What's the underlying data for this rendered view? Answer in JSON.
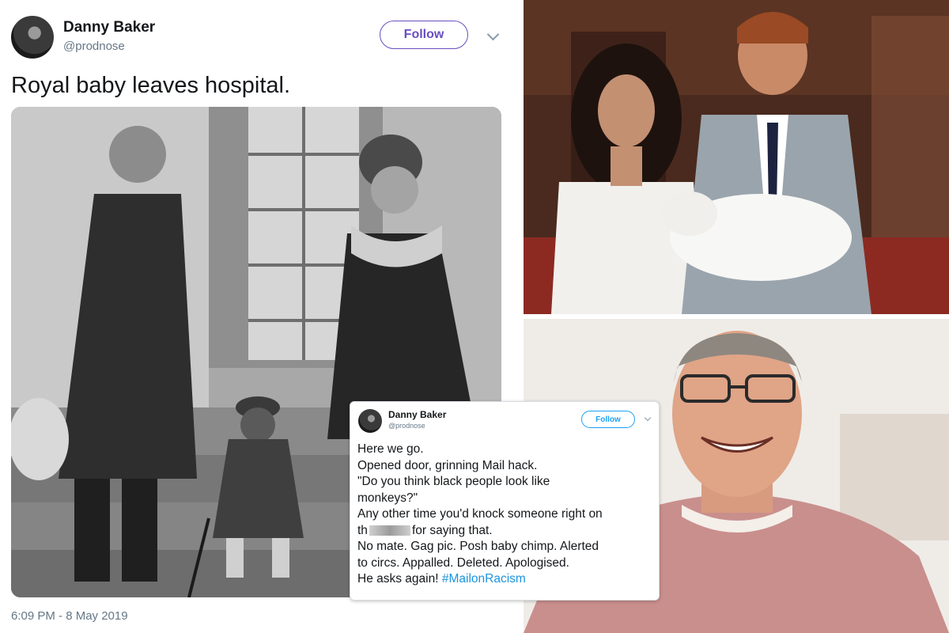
{
  "main_tweet": {
    "name": "Danny Baker",
    "handle": "@prodnose",
    "follow_label": "Follow",
    "text": "Royal baby leaves hospital.",
    "timestamp": "6:09 PM - 8 May 2019"
  },
  "inset_tweet": {
    "name": "Danny Baker",
    "handle": "@prodnose",
    "follow_label": "Follow",
    "lines": {
      "l1": "Here we go.",
      "l2": "Opened door, grinning Mail hack.",
      "l3": "\"Do you think black people look like",
      "l4": "monkeys?\"",
      "l5": "Any other time you'd knock someone right on",
      "l6a": "th",
      "l6b": "for saying that.",
      "l7": "No mate. Gag pic. Posh baby chimp. Alerted",
      "l8": "to circs. Appalled. Deleted. Apologised.",
      "l9a": "He asks again!",
      "l9b": "#MailonRacism"
    }
  },
  "colors": {
    "follow_purple": "#6a4ec0",
    "twitter_blue": "#1da1f2",
    "hashtag_blue": "#1b95e0"
  }
}
